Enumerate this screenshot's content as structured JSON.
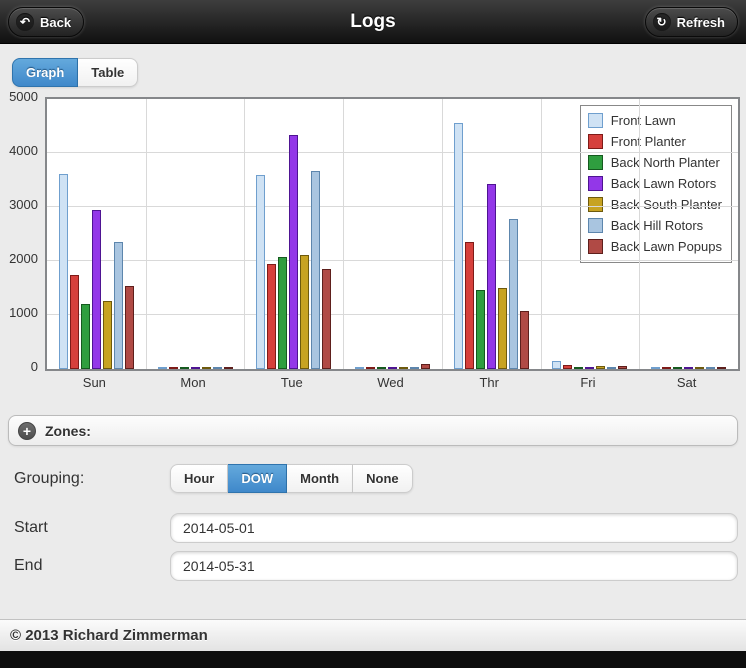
{
  "header": {
    "title": "Logs",
    "back_label": "Back",
    "refresh_label": "Refresh"
  },
  "icons": {
    "back": "↶",
    "refresh": "↻",
    "plus": "+"
  },
  "view_toggle": {
    "graph_label": "Graph",
    "table_label": "Table",
    "selected": "Graph"
  },
  "chart_data": {
    "type": "bar",
    "categories": [
      "Sun",
      "Mon",
      "Tue",
      "Wed",
      "Thr",
      "Fri",
      "Sat"
    ],
    "series": [
      {
        "name": "Front Lawn",
        "fill": "#cfe2f4",
        "border": "#6f9fce",
        "values": [
          3610,
          30,
          3590,
          40,
          4550,
          150,
          30
        ]
      },
      {
        "name": "Front Planter",
        "fill": "#d6403c",
        "border": "#7e1b18",
        "values": [
          1740,
          25,
          1940,
          35,
          2350,
          80,
          20
        ]
      },
      {
        "name": "Back North Planter",
        "fill": "#2f9e3f",
        "border": "#155a1f",
        "values": [
          1200,
          35,
          2070,
          35,
          1460,
          40,
          30
        ]
      },
      {
        "name": "Back Lawn Rotors",
        "fill": "#9337e8",
        "border": "#4e1492",
        "values": [
          2940,
          25,
          4330,
          30,
          3430,
          35,
          20
        ]
      },
      {
        "name": "Back South Planter",
        "fill": "#c7a322",
        "border": "#6e5a0d",
        "values": [
          1260,
          30,
          2110,
          35,
          1500,
          50,
          25
        ]
      },
      {
        "name": "Back Hill Rotors",
        "fill": "#a9c5e0",
        "border": "#5d86ad",
        "values": [
          2350,
          20,
          3670,
          30,
          2780,
          35,
          20
        ]
      },
      {
        "name": "Back Lawn Popups",
        "fill": "#b04a45",
        "border": "#5e1f1c",
        "values": [
          1540,
          25,
          1850,
          100,
          1070,
          60,
          30
        ]
      }
    ],
    "title": "",
    "xlabel": "",
    "ylabel": "",
    "ylim": [
      0,
      5000
    ],
    "yticks": [
      0,
      1000,
      2000,
      3000,
      4000,
      5000
    ],
    "grid": true,
    "legend_position": "top-right"
  },
  "zones": {
    "label": "Zones:"
  },
  "grouping": {
    "label": "Grouping:",
    "options": [
      "Hour",
      "DOW",
      "Month",
      "None"
    ],
    "selected": "DOW"
  },
  "start": {
    "label": "Start",
    "value": "2014-05-01"
  },
  "end": {
    "label": "End",
    "value": "2014-05-31"
  },
  "footer": {
    "copyright": "© 2013 Richard Zimmerman"
  },
  "colors": {
    "accent": "#4f94d4",
    "header_bg": "#1c1c1c",
    "plot_border": "#85878a"
  }
}
